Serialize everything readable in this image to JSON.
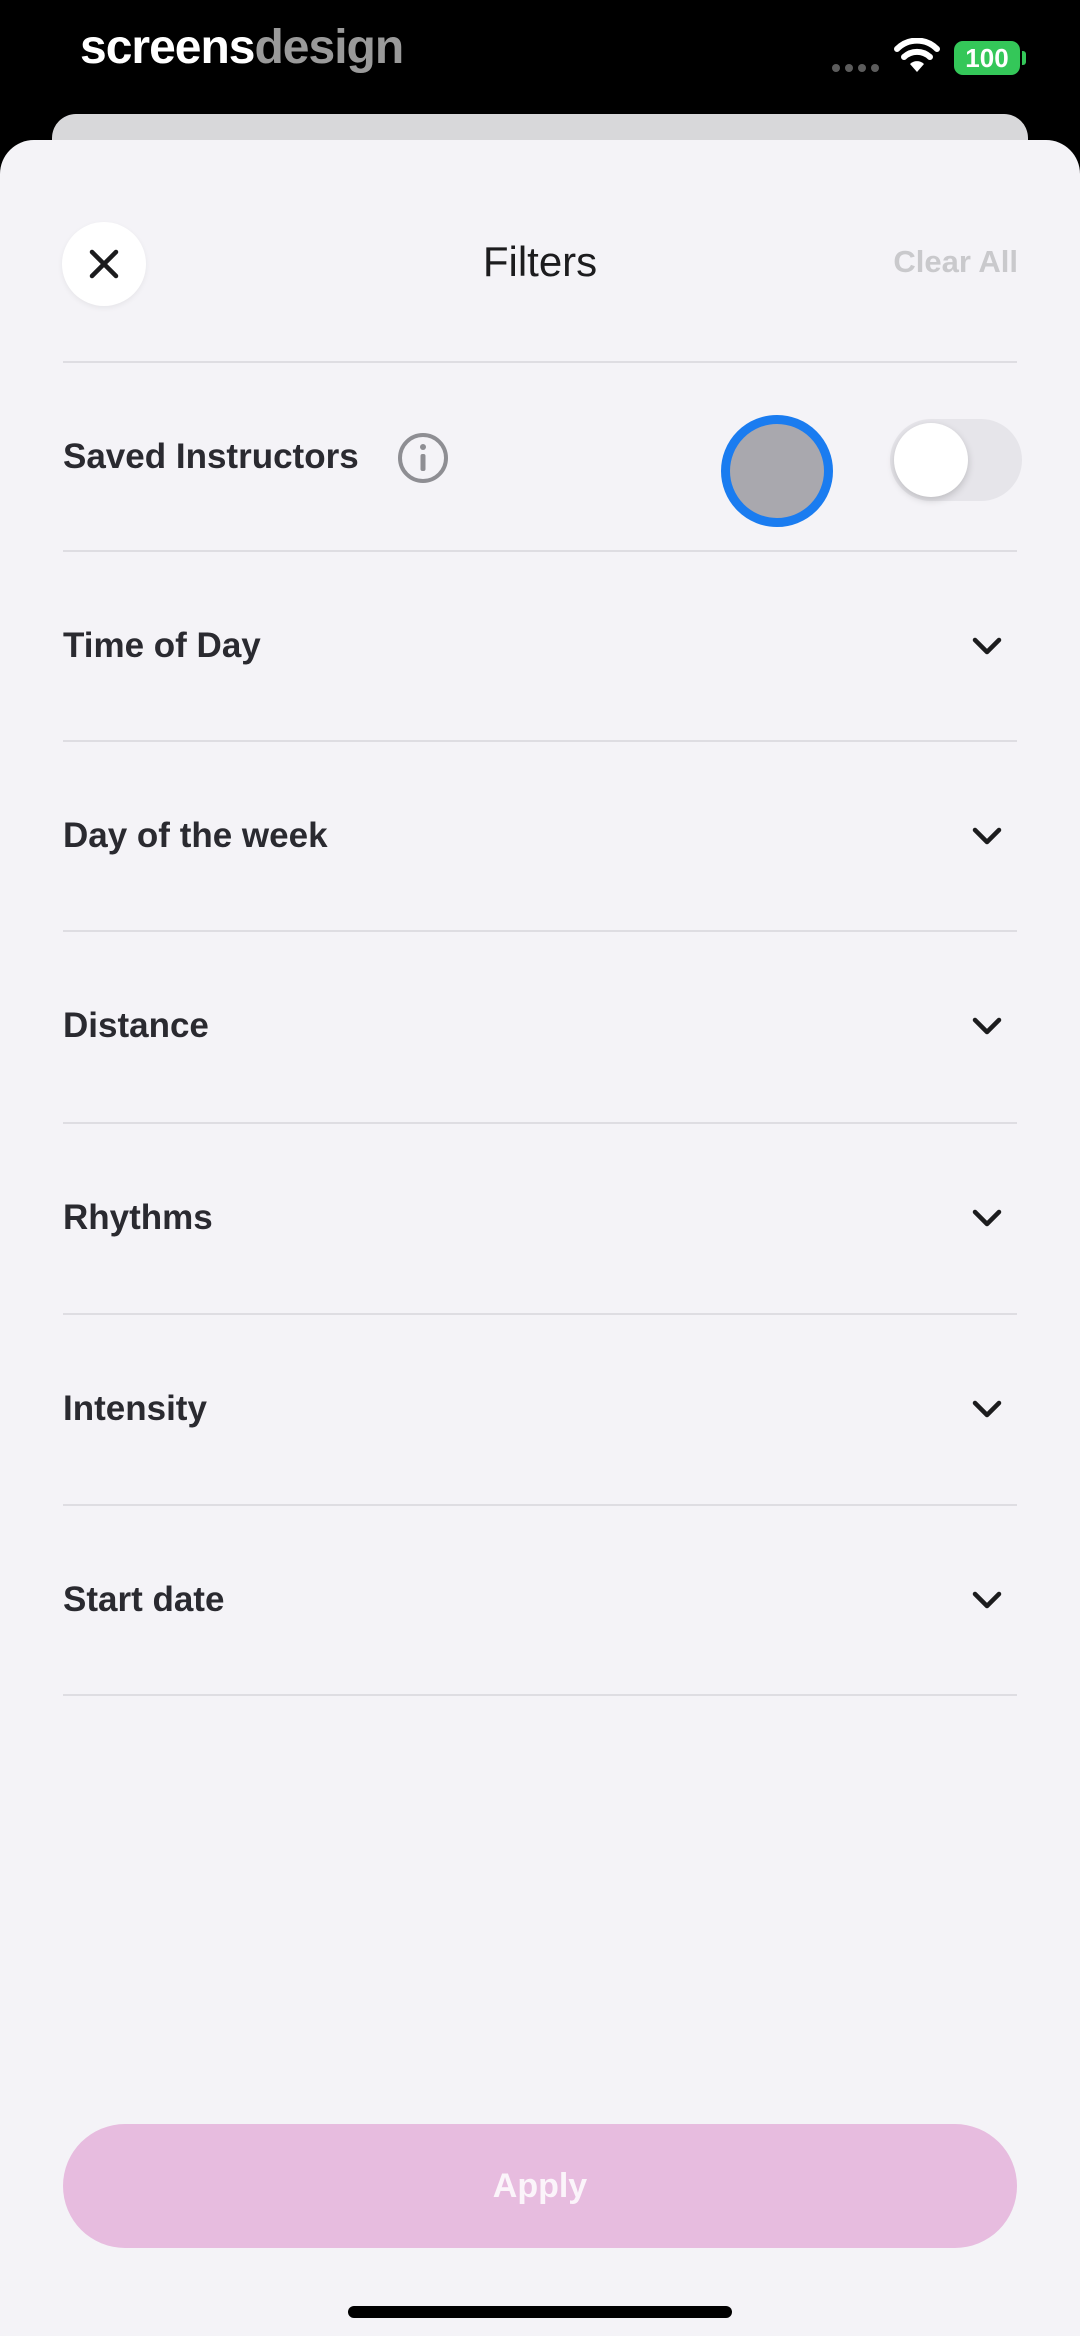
{
  "status_bar": {
    "brand_part1": "screens",
    "brand_part2": "design",
    "battery": "100",
    "battery_color": "#34c759"
  },
  "header": {
    "title": "Filters",
    "clear_all": "Clear All",
    "close_icon": "close-icon"
  },
  "saved_instructors": {
    "label": "Saved Instructors",
    "info_icon": "info-icon",
    "toggle_on": false
  },
  "filters": [
    {
      "label": "Time of Day",
      "icon": "chevron-down-icon"
    },
    {
      "label": "Day of the week",
      "icon": "chevron-down-icon"
    },
    {
      "label": "Distance",
      "icon": "chevron-down-icon"
    },
    {
      "label": "Rhythms",
      "icon": "chevron-down-icon"
    },
    {
      "label": "Intensity",
      "icon": "chevron-down-icon"
    },
    {
      "label": "Start date",
      "icon": "chevron-down-icon"
    }
  ],
  "apply": {
    "label": "Apply",
    "color": "#e7bcdf"
  },
  "colors": {
    "sheet_background": "#f4f3f7",
    "touch_ring": "#1a7cf0"
  }
}
